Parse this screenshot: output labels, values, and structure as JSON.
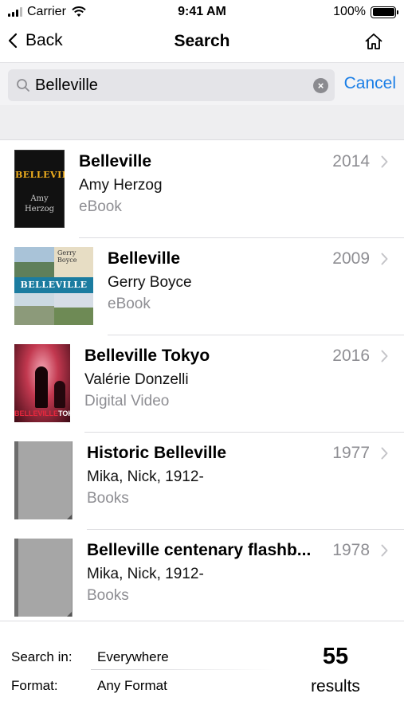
{
  "status_bar": {
    "carrier": "Carrier",
    "time": "9:41 AM",
    "battery": "100%"
  },
  "nav": {
    "back_label": "Back",
    "title": "Search"
  },
  "search": {
    "query": "Belleville",
    "cancel_label": "Cancel"
  },
  "results": [
    {
      "title": "Belleville",
      "author": "Amy Herzog",
      "format": "eBook",
      "year": "2014",
      "cover": {
        "title": "BELLEVILLE",
        "author_line1": "Amy",
        "author_line2": "Herzog"
      }
    },
    {
      "title": "Belleville",
      "author": "Gerry Boyce",
      "format": "eBook",
      "year": "2009",
      "cover": {
        "title": "BELLEVILLE",
        "author": "Gerry Boyce"
      }
    },
    {
      "title": "Belleville Tokyo",
      "author": "Valérie Donzelli",
      "format": "Digital Video",
      "year": "2016",
      "cover": {
        "title_part1": "BELLEVILLE",
        "title_part2": "TOKYO"
      }
    },
    {
      "title": "Historic Belleville",
      "author": "Mika, Nick, 1912-",
      "format": "Books",
      "year": "1977"
    },
    {
      "title": "Belleville centenary flashb...",
      "author": "Mika, Nick, 1912-",
      "format": "Books",
      "year": "1978"
    }
  ],
  "filters": {
    "search_in_label": "Search in:",
    "search_in_value": "Everywhere",
    "format_label": "Format:",
    "format_value": "Any Format"
  },
  "summary": {
    "count": "55",
    "label": "results"
  },
  "colors": {
    "accent": "#1a7ee6",
    "secondary_text": "#8e8e93"
  }
}
